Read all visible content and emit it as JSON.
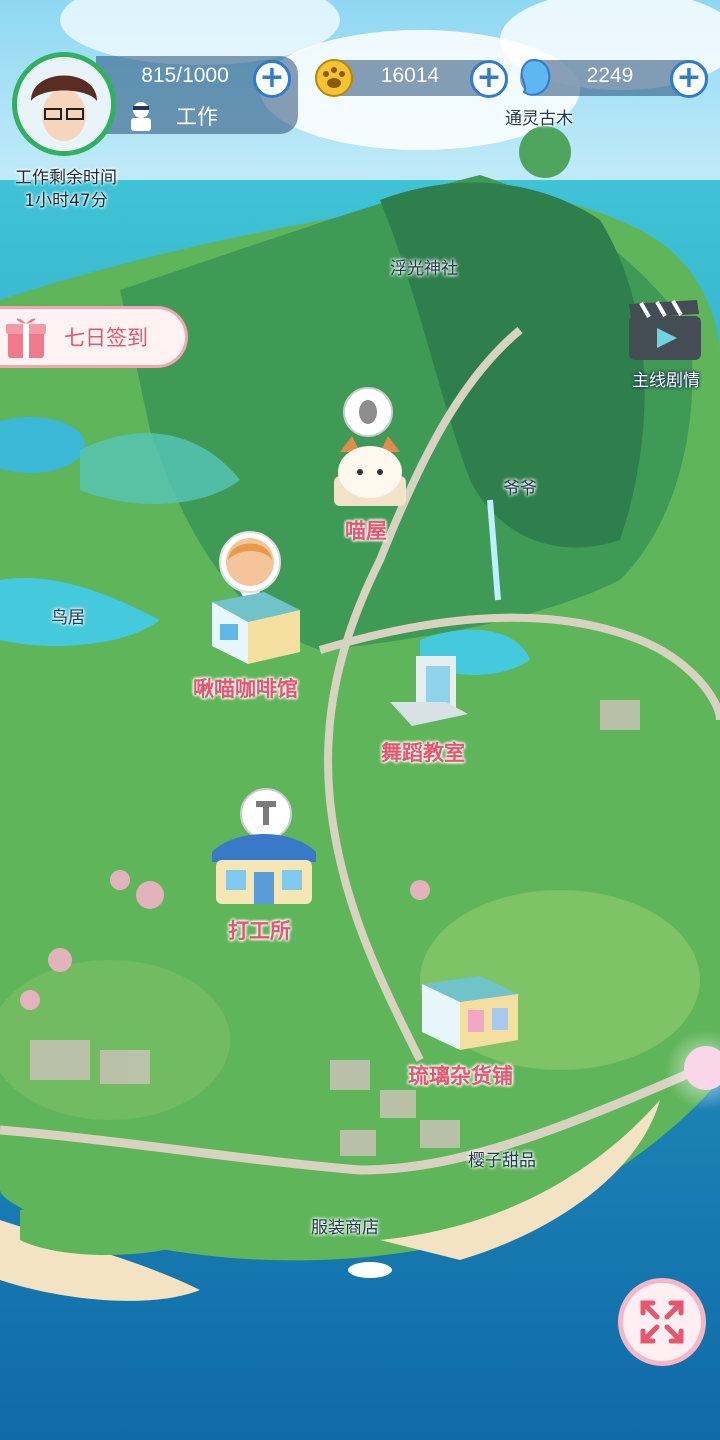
{
  "player": {
    "energy": "815/1000",
    "status": "工作",
    "work_remaining_label": "工作剩余时间",
    "work_remaining_value": "1小时47分"
  },
  "currencies": [
    {
      "name": "paw-coin",
      "icon": "paw-coin-icon",
      "value": "16014"
    },
    {
      "name": "spirit-gem",
      "icon": "blue-spirit-icon",
      "value": "2249"
    }
  ],
  "buttons": {
    "daily_signin": "七日签到",
    "main_story": "主线剧情",
    "plus": "+"
  },
  "map_places": {
    "ancient_tree": "通灵古木",
    "shrine": "浮光神社",
    "grandpa": "爷爷",
    "torii": "鸟居",
    "sakura_sweets": "樱子甜品",
    "clothing_store": "服装商店"
  },
  "buildings": {
    "cat_house": "喵屋",
    "cafe": "啾喵咖啡馆",
    "dance_school": "舞蹈教室",
    "job_center": "打工所",
    "glass_shop": "琉璃杂货铺"
  },
  "colors": {
    "accent_pink": "#e8556c",
    "hud_blue": "#2e7bd1",
    "energy_ring": "#2fb15f"
  }
}
